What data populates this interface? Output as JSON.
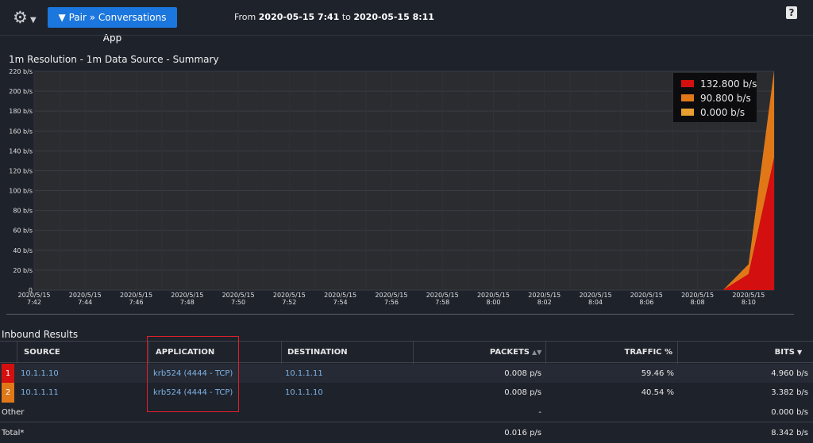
{
  "toolbar": {
    "gear_icon": "gear-icon",
    "pair_button_label": "▼ Pair » Conversations App",
    "date_from_prefix": "From",
    "date_from": "2020-05-15 7:41",
    "date_to_word": "to",
    "date_to": "2020-05-15 8:11",
    "help_label": "?"
  },
  "chart_data": {
    "type": "area",
    "title": "1m Resolution - 1m Data Source - Summary",
    "xlabel": "",
    "ylabel": "",
    "y_unit": "b/s",
    "ylim": [
      0,
      220
    ],
    "y_ticks": [
      "0",
      "20 b/s",
      "40 b/s",
      "60 b/s",
      "80 b/s",
      "100 b/s",
      "120 b/s",
      "140 b/s",
      "160 b/s",
      "180 b/s",
      "200 b/s",
      "220 b/s"
    ],
    "x_ticks": [
      [
        "2020/5/15",
        "7:42"
      ],
      [
        "2020/5/15",
        "7:44"
      ],
      [
        "2020/5/15",
        "7:46"
      ],
      [
        "2020/5/15",
        "7:48"
      ],
      [
        "2020/5/15",
        "7:50"
      ],
      [
        "2020/5/15",
        "7:52"
      ],
      [
        "2020/5/15",
        "7:54"
      ],
      [
        "2020/5/15",
        "7:56"
      ],
      [
        "2020/5/15",
        "7:58"
      ],
      [
        "2020/5/15",
        "8:00"
      ],
      [
        "2020/5/15",
        "8:02"
      ],
      [
        "2020/5/15",
        "8:04"
      ],
      [
        "2020/5/15",
        "8:06"
      ],
      [
        "2020/5/15",
        "8:08"
      ],
      [
        "2020/5/15",
        "8:10"
      ]
    ],
    "x_minutes": [
      "7:42",
      "7:43",
      "7:44",
      "7:45",
      "7:46",
      "7:47",
      "7:48",
      "7:49",
      "7:50",
      "7:51",
      "7:52",
      "7:53",
      "7:54",
      "7:55",
      "7:56",
      "7:57",
      "7:58",
      "7:59",
      "8:00",
      "8:01",
      "8:02",
      "8:03",
      "8:04",
      "8:05",
      "8:06",
      "8:07",
      "8:08",
      "8:09",
      "8:10",
      "8:11"
    ],
    "stacked": true,
    "series": [
      {
        "name": "132.800 b/s",
        "color": "#d40f0f",
        "values": [
          0,
          0,
          0,
          0,
          0,
          0,
          0,
          0,
          0,
          0,
          0,
          0,
          0,
          0,
          0,
          0,
          0,
          0,
          0,
          0,
          0,
          0,
          0,
          0,
          0,
          0,
          0,
          0,
          16,
          133
        ]
      },
      {
        "name": "90.800 b/s",
        "color": "#e07818",
        "values": [
          0,
          0,
          0,
          0,
          0,
          0,
          0,
          0,
          0,
          0,
          0,
          0,
          0,
          0,
          0,
          0,
          0,
          0,
          0,
          0,
          0,
          0,
          0,
          0,
          0,
          0,
          0,
          0,
          10,
          88
        ]
      },
      {
        "name": "0.000 b/s",
        "color": "#e8a030",
        "values": [
          0,
          0,
          0,
          0,
          0,
          0,
          0,
          0,
          0,
          0,
          0,
          0,
          0,
          0,
          0,
          0,
          0,
          0,
          0,
          0,
          0,
          0,
          0,
          0,
          0,
          0,
          0,
          0,
          0,
          0
        ]
      }
    ],
    "grid": true,
    "legend_position": "top-right"
  },
  "results": {
    "title": "Inbound Results",
    "columns": {
      "source": "SOURCE",
      "application": "APPLICATION",
      "destination": "DESTINATION",
      "packets": "PACKETS",
      "traffic": "TRAFFIC %",
      "bits": "BITS"
    },
    "rows": [
      {
        "rank": "1",
        "rank_color": "#d40f0f",
        "source": "10.1.1.10",
        "application": "krb524 (4444 - TCP)",
        "destination": "10.1.1.11",
        "packets": "0.008 p/s",
        "traffic": "59.46 %",
        "bits": "4.960 b/s"
      },
      {
        "rank": "2",
        "rank_color": "#e07818",
        "source": "10.1.1.11",
        "application": "krb524 (4444 - TCP)",
        "destination": "10.1.1.10",
        "packets": "0.008 p/s",
        "traffic": "40.54 %",
        "bits": "3.382 b/s"
      }
    ],
    "other": {
      "label": "Other",
      "packets": "-",
      "bits": "0.000 b/s"
    },
    "total": {
      "label": "Total*",
      "packets": "0.016 p/s",
      "bits": "8.342 b/s"
    }
  }
}
